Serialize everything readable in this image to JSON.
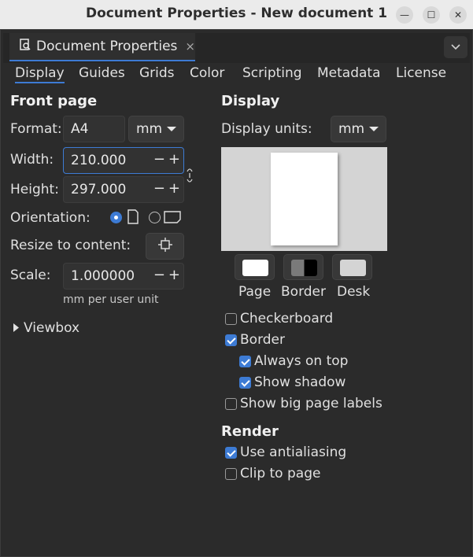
{
  "window": {
    "title": "Document Properties - New document 1"
  },
  "dock": {
    "tab_label": "Document Properties",
    "tab_close": "×"
  },
  "tabs": [
    "Display",
    "Guides",
    "Grids",
    "Color",
    "Scripting",
    "Metadata",
    "License"
  ],
  "front_page": {
    "heading": "Front page",
    "format_label": "Format:",
    "format_value": "A4",
    "format_unit": "mm",
    "width_label": "Width:",
    "width_value": "210.000",
    "height_label": "Height:",
    "height_value": "297.000",
    "orientation_label": "Orientation:",
    "orientation": "portrait",
    "resize_label": "Resize to content:",
    "scale_label": "Scale:",
    "scale_value": "1.000000",
    "scale_note": "mm per user unit",
    "viewbox_label": "Viewbox"
  },
  "display": {
    "heading": "Display",
    "units_label": "Display units:",
    "units_value": "mm",
    "color_buttons": [
      "Page",
      "Border",
      "Desk"
    ],
    "checkboxes": {
      "checkerboard": {
        "label": "Checkerboard",
        "checked": false
      },
      "border": {
        "label": "Border",
        "checked": true
      },
      "always_on_top": {
        "label": "Always on top",
        "checked": true
      },
      "show_shadow": {
        "label": "Show shadow",
        "checked": true
      },
      "big_page_labels": {
        "label": "Show big page labels",
        "checked": false
      }
    }
  },
  "render": {
    "heading": "Render",
    "antialiasing": {
      "label": "Use antialiasing",
      "checked": true
    },
    "clip_to_page": {
      "label": "Clip to page",
      "checked": false
    }
  },
  "colors": {
    "accent": "#3d7bd4",
    "background": "#2b2b2b",
    "titlebar": "#ebebeb",
    "desk": "#d4d4d4"
  }
}
